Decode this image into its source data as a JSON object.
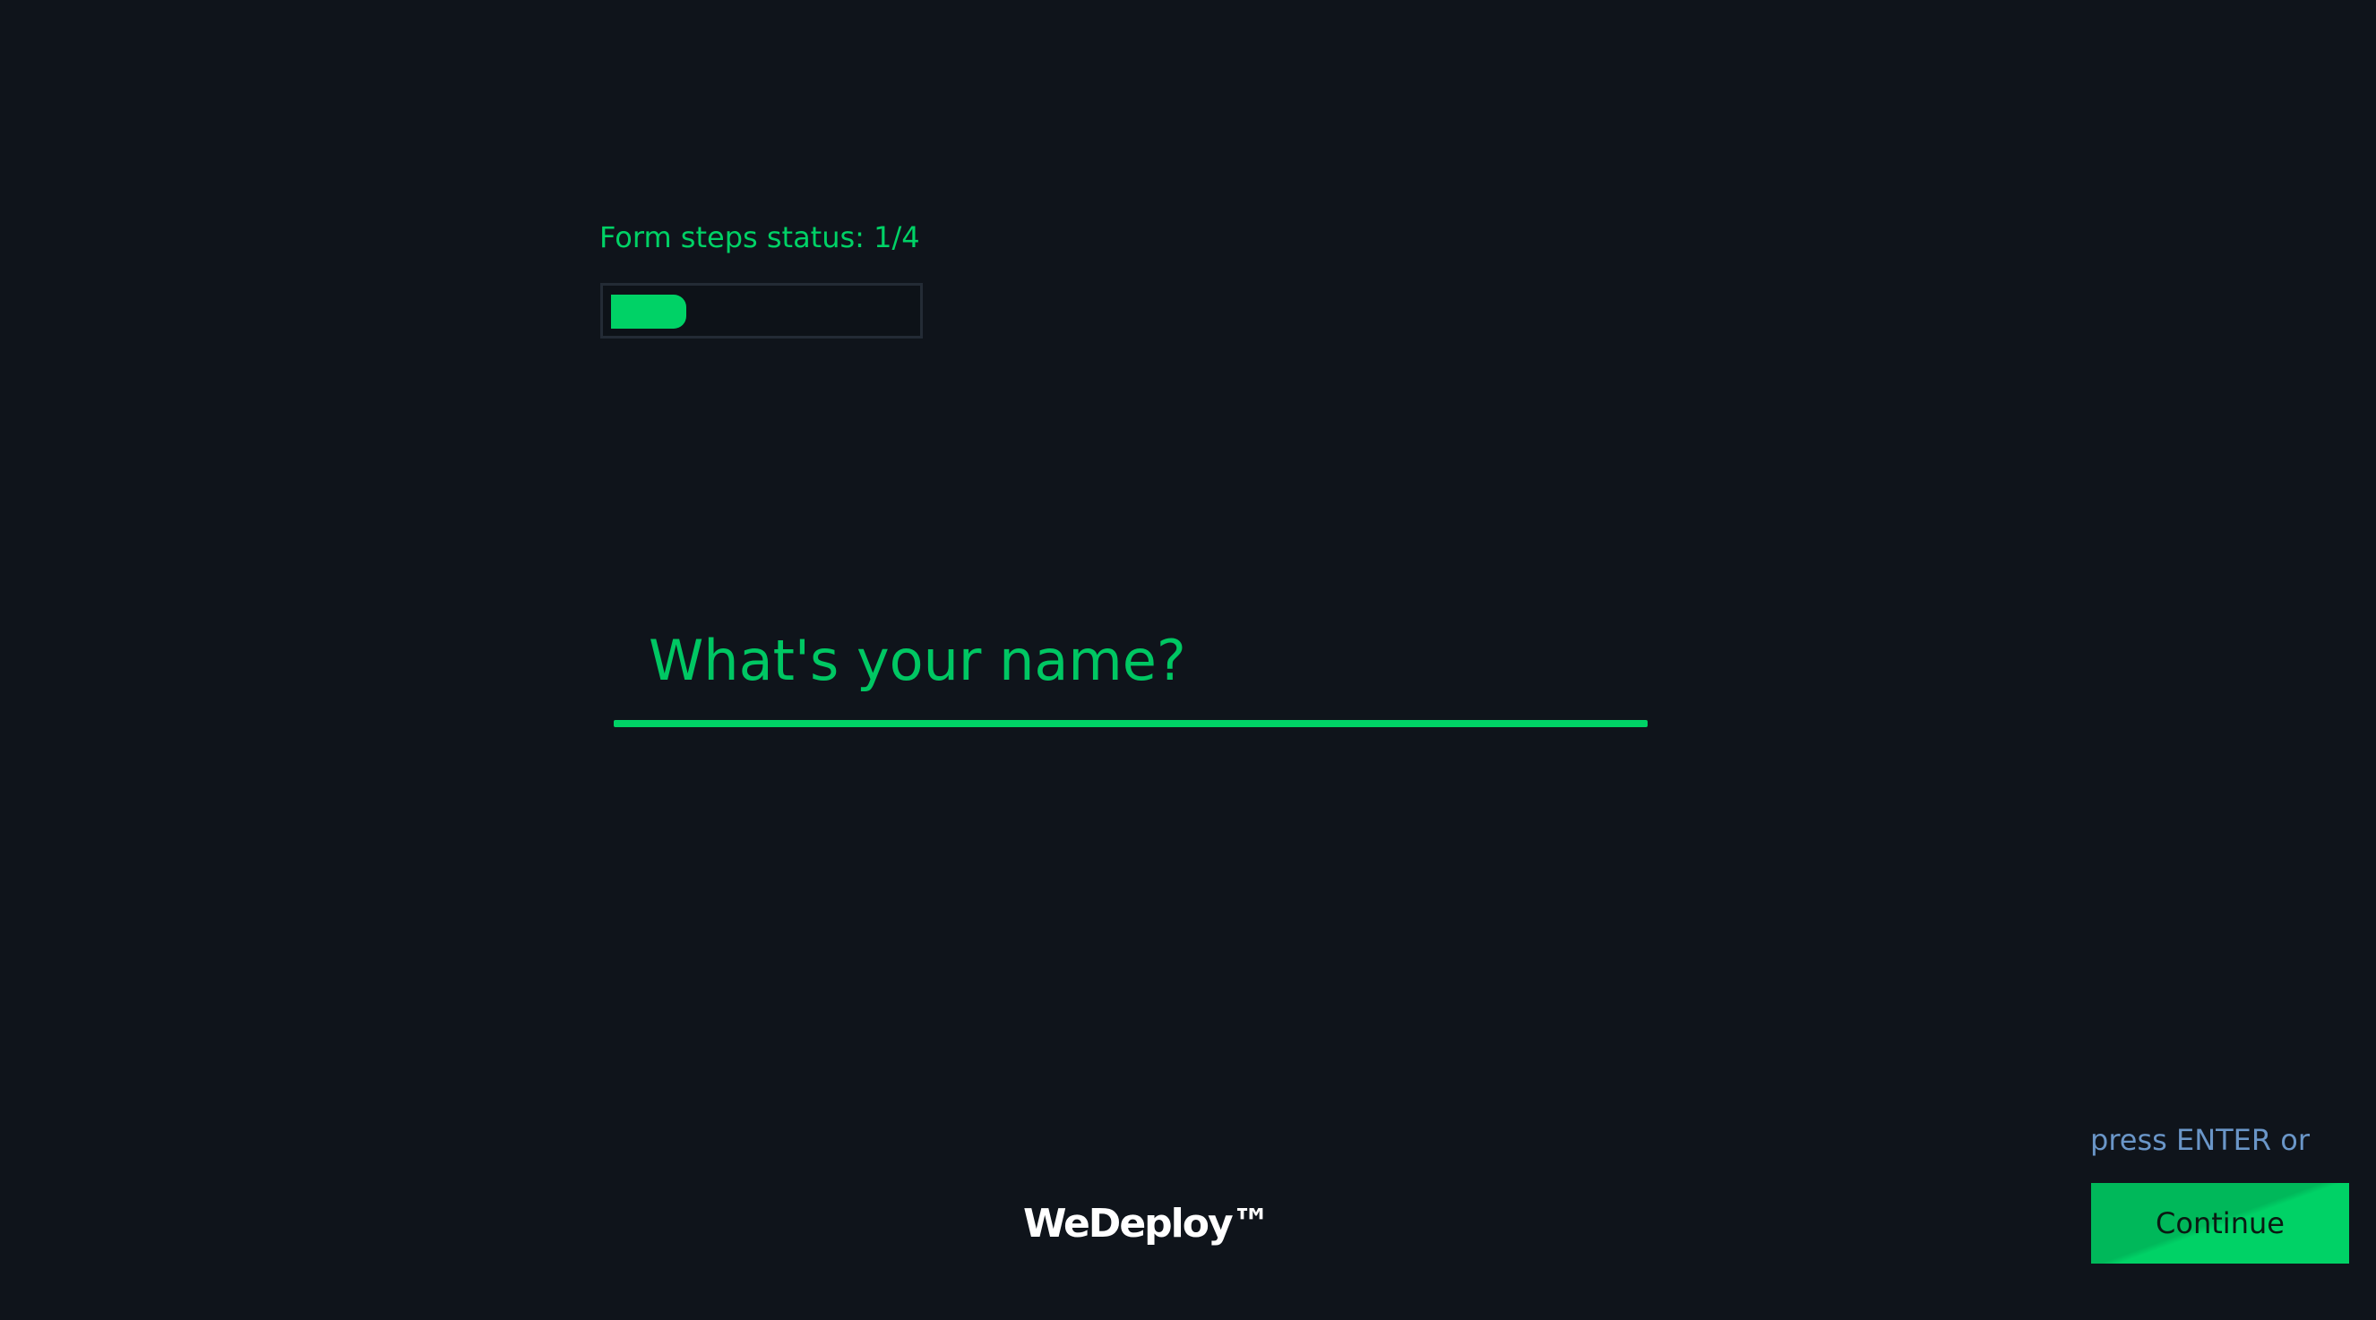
{
  "steps": {
    "status_label": "Form steps status: 1/4",
    "current": 1,
    "total": 4,
    "progress_fraction": 0.25
  },
  "question": {
    "placeholder": "What's your name?",
    "value": ""
  },
  "actions": {
    "hint": "press ENTER or",
    "continue_label": "Continue"
  },
  "footer": {
    "brand": "WeDeploy™"
  },
  "colors": {
    "background": "#0f141b",
    "accent": "#00d266",
    "hint": "#6a96c8",
    "track_border": "#232b35"
  }
}
